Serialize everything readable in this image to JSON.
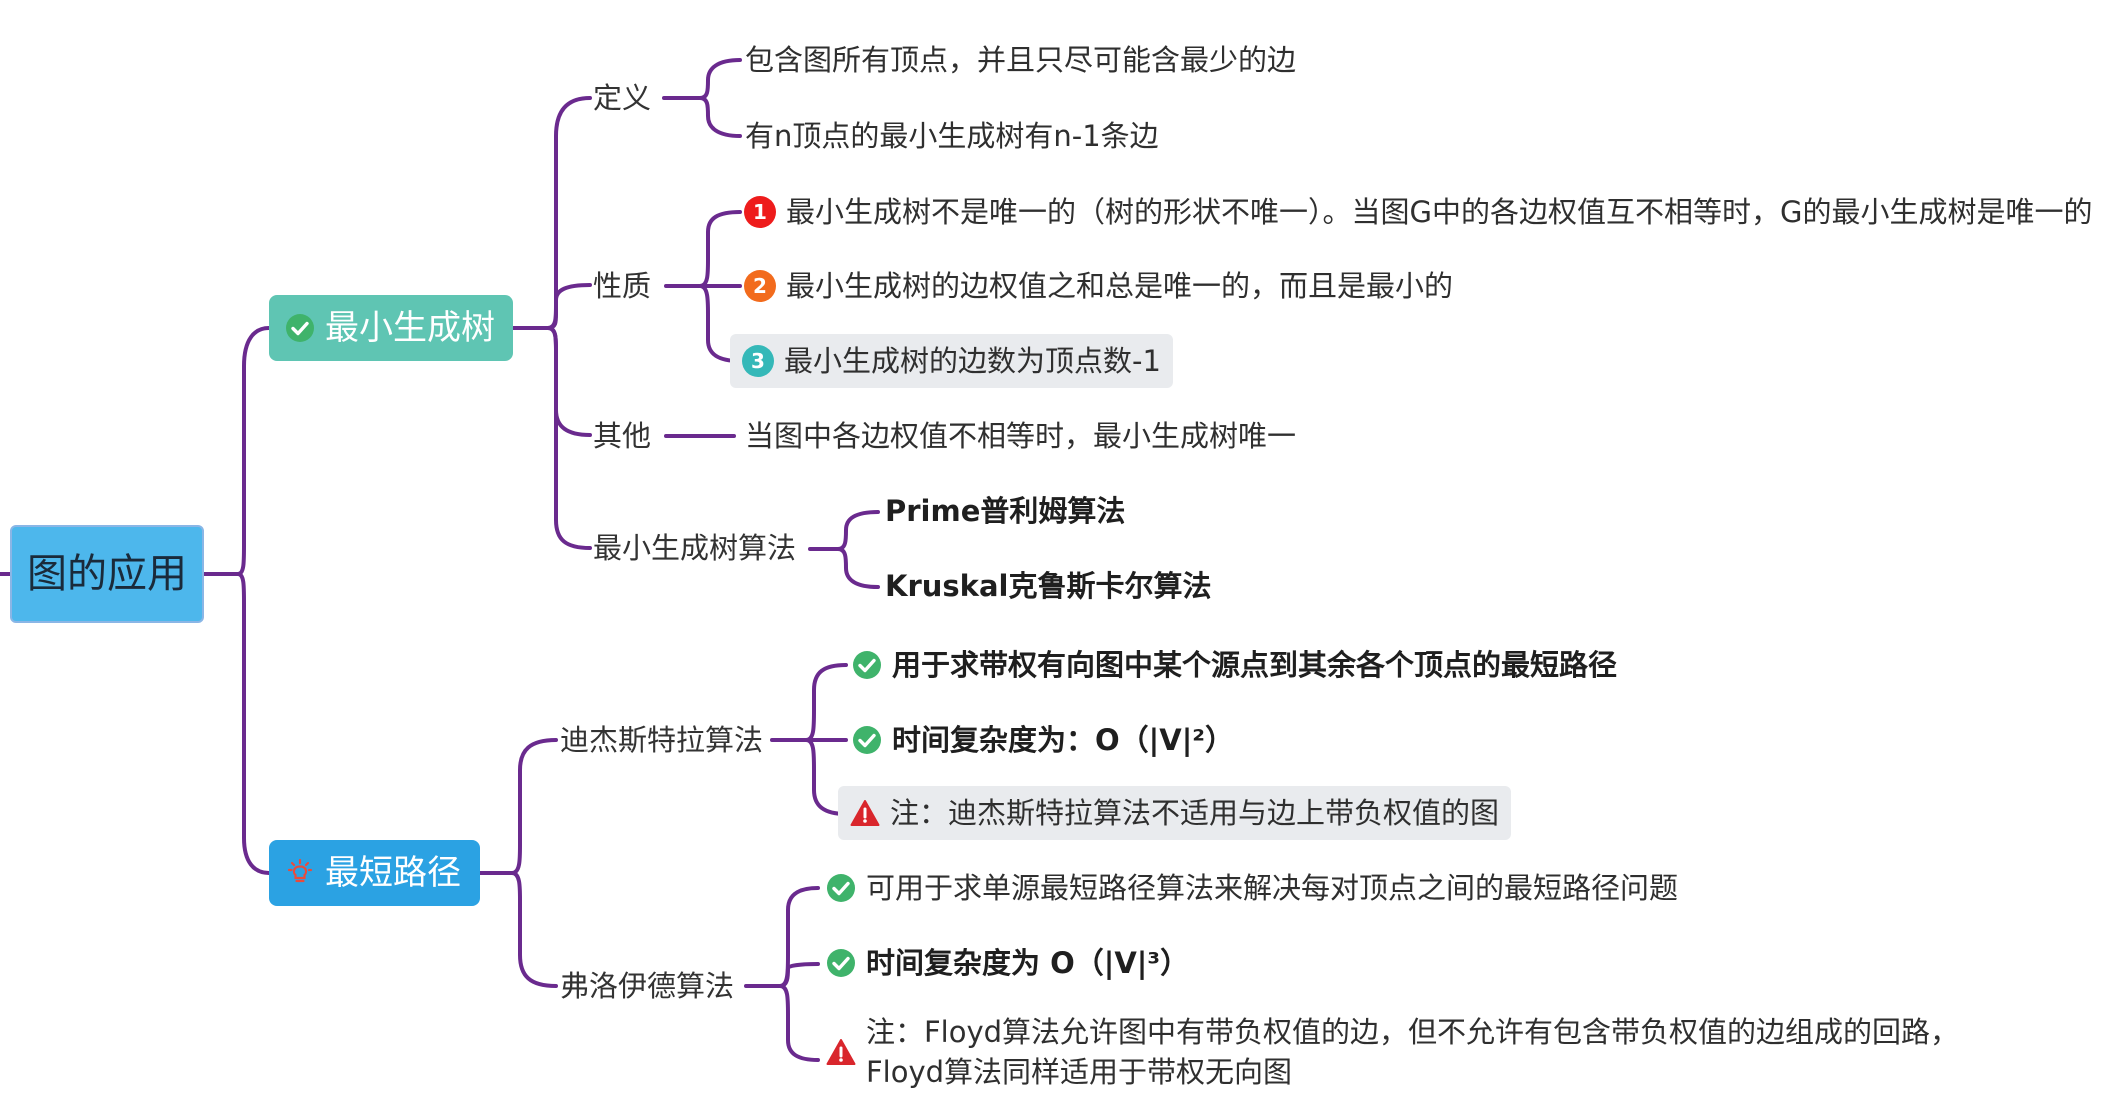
{
  "colors": {
    "line": "#6a2a8e",
    "root_fill": "#4db7ec",
    "branch1_fill": "#5fc5b3",
    "branch2_fill": "#2ba2e3",
    "check": "#3fb36b",
    "warn": "#d9262c",
    "badge1": "#ee1c1c",
    "badge2": "#f26b1d",
    "badge3": "#35b8b8"
  },
  "root": {
    "label": "图的应用"
  },
  "branch1": {
    "label": "最小生成树",
    "icon": "check-circle-icon",
    "definition": {
      "label": "定义",
      "items": [
        "包含图所有顶点，并且只尽可能含最少的边",
        "有n顶点的最小生成树有n-1条边"
      ]
    },
    "properties": {
      "label": "性质",
      "items": [
        {
          "num": "1",
          "text": "最小生成树不是唯一的（树的形状不唯一）。当图G中的各边权值互不相等时，G的最小生成树是唯一的"
        },
        {
          "num": "2",
          "text": "最小生成树的边权值之和总是唯一的，而且是最小的"
        },
        {
          "num": "3",
          "text": "最小生成树的边数为顶点数-1"
        }
      ]
    },
    "other": {
      "label": "其他",
      "text": "当图中各边权值不相等时，最小生成树唯一"
    },
    "algorithms": {
      "label": "最小生成树算法",
      "items": [
        "Prime普利姆算法",
        "Kruskal克鲁斯卡尔算法"
      ]
    }
  },
  "branch2": {
    "label": "最短路径",
    "icon": "lightbulb-icon",
    "dijkstra": {
      "label": "迪杰斯特拉算法",
      "items": [
        "用于求带权有向图中某个源点到其余各个顶点的最短路径",
        "时间复杂度为：O（|V|²）",
        "注：迪杰斯特拉算法不适用与边上带负权值的图"
      ]
    },
    "floyd": {
      "label": "弗洛伊德算法",
      "items": [
        "可用于求单源最短路径算法来解决每对顶点之间的最短路径问题",
        "时间复杂度为 O（|V|³）"
      ],
      "note_line1": "注：Floyd算法允许图中有带负权值的边，但不允许有包含带负权值的边组成的回路，",
      "note_line2": "Floyd算法同样适用于带权无向图"
    }
  }
}
